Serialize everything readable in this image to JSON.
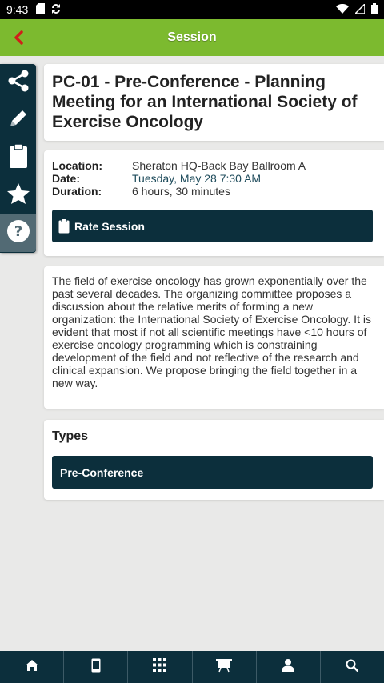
{
  "status_bar": {
    "time": "9:43"
  },
  "header": {
    "title": "Session"
  },
  "sidebar": {
    "items": [
      "share-icon",
      "pencil-icon",
      "clipboard-icon",
      "star-icon",
      "help-icon"
    ]
  },
  "session": {
    "title": "PC-01 - Pre-Conference - Planning Meeting for an International Society of Exercise Oncology",
    "location_label": "Location:",
    "location": "Sheraton HQ-Back Bay Ballroom A",
    "date_label": "Date:",
    "date": "Tuesday, May 28 7:30 AM",
    "duration_label": "Duration:",
    "duration": "6 hours, 30 minutes",
    "rate_button": "Rate Session",
    "description": "The field of exercise oncology has grown exponentially over the past several decades. The organizing committee proposes a discussion about the relative merits of forming a new organization: the International Society of Exercise Oncology. It is evident that most if not all scientific meetings have <10 hours of exercise oncology programming which is constraining development of the field and not reflective of the research and clinical expansion. We propose bringing the field together in a new way.",
    "types_heading": "Types",
    "types": [
      "Pre-Conference"
    ]
  },
  "bottom_nav": [
    "home-icon",
    "mobile-icon",
    "grid-icon",
    "presentation-icon",
    "person-icon",
    "search-icon"
  ],
  "colors": {
    "accent": "#7cba2f",
    "primary_dark": "#0c2f3c",
    "back_arrow": "#d0201a",
    "link": "#1f4c5c"
  }
}
